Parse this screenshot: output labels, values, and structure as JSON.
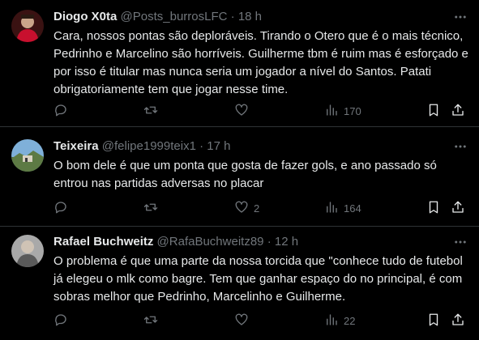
{
  "tweets": [
    {
      "name": "Diogo X0ta",
      "handle": "@Posts_burrosLFC",
      "dot": "·",
      "time": "18 h",
      "text": "Cara, nossos pontas são deploráveis. Tirando o Otero que é o mais técnico, Pedrinho e Marcelino são horríveis. Guilherme tbm é ruim mas é esforçado e por isso é titular mas nunca seria um jogador a nível do Santos. Patati obrigatoriamente tem que jogar nesse time.",
      "likes": "",
      "views": "170"
    },
    {
      "name": "Teixeira",
      "handle": "@felipe1999teix1",
      "dot": "·",
      "time": "17 h",
      "text": "O bom dele é que um ponta que gosta de fazer gols, e ano passado só entrou nas partidas adversas no placar",
      "likes": "2",
      "views": "164"
    },
    {
      "name": "Rafael Buchweitz",
      "handle": "@RafaBuchweitz89",
      "dot": "·",
      "time": "12 h",
      "text": "O problema é que uma parte da nossa torcida que \"conhece tudo de futebol já elegeu o mlk como bagre. Tem que ganhar espaço do no principal, é com sobras melhor que Pedrinho, Marcelinho e Guilherme.",
      "likes": "",
      "views": "22"
    }
  ],
  "icons": {
    "reply": "reply-icon",
    "retweet": "retweet-icon",
    "like": "heart-icon",
    "views": "views-icon",
    "bookmark": "bookmark-icon",
    "share": "share-icon",
    "more": "more-icon"
  },
  "colors": {
    "background": "#000000",
    "text": "#e7e9ea",
    "muted": "#71767b",
    "divider": "#2f3336"
  }
}
